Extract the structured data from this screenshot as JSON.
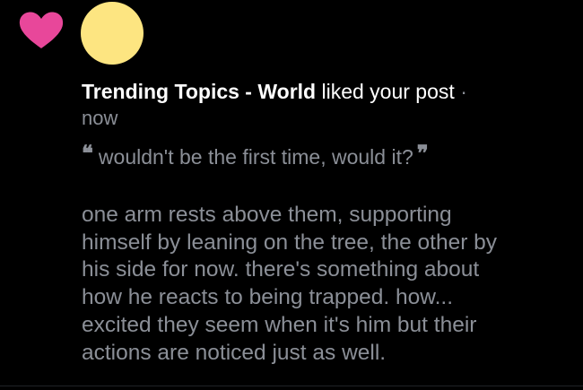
{
  "notification": {
    "icon": "heart-icon",
    "icon_color": "#e8479a",
    "avatar_color": "#fde581",
    "actor": "Trending Topics - World",
    "action": "liked your post",
    "separator": "·",
    "time": "now",
    "quote": "wouldn't be the first time, would it?",
    "quote_open": "❝",
    "quote_close": "❞",
    "excerpt_lines": [
      "one arm rests above them, supporting",
      "himself by leaning on the tree, the other by",
      "his side for now. there's something about",
      "how he reacts to being trapped. how...",
      "excited they seem when it's him but their",
      "actions are noticed just as well."
    ]
  }
}
